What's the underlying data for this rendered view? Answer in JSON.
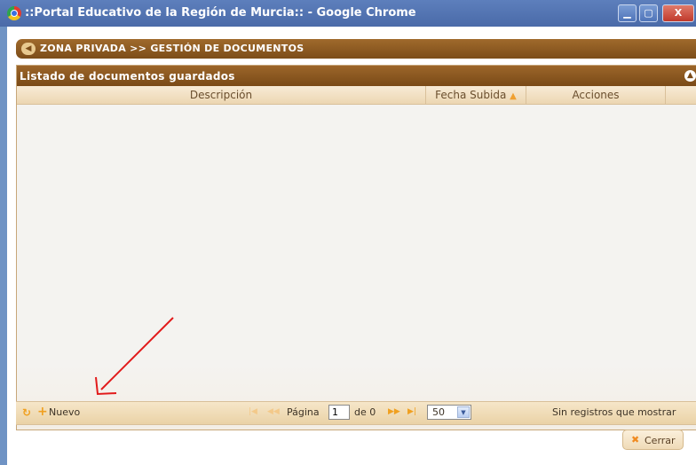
{
  "window": {
    "title": "::Portal Educativo de la Región de Murcia:: - Google Chrome",
    "min_label": "▁",
    "max_label": "▢",
    "close_label": "X"
  },
  "breadcrumb": {
    "back_icon": "back-arrow-icon",
    "text": "ZONA PRIVADA >> GESTIÓN DE DOCUMENTOS"
  },
  "panel": {
    "title": "Listado de documentos guardados",
    "collapse_icon": "collapse-icon",
    "columns": [
      "Descripción",
      "Fecha Subida",
      "Acciones"
    ],
    "sort_indicator": "▲",
    "rows": []
  },
  "pager": {
    "add_label": "Nuevo",
    "page_label": "Página",
    "page_value": "1",
    "of_label": "de 0",
    "page_size": "50",
    "status": "Sin registros que mostrar"
  },
  "footer": {
    "close_label": "Cerrar"
  },
  "colors": {
    "titlebar": "#4a6aa8",
    "header_brown": "#7a4a17",
    "accent_orange": "#f0a020",
    "annotation_red": "#e21b1b"
  }
}
